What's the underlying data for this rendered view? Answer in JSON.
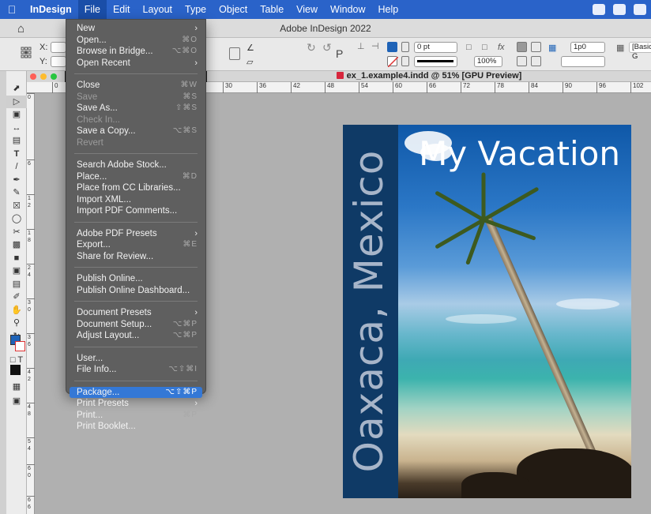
{
  "menubar": {
    "app_name": "InDesign",
    "items": [
      "File",
      "Edit",
      "Layout",
      "Type",
      "Object",
      "Table",
      "View",
      "Window",
      "Help"
    ],
    "active": "File"
  },
  "window": {
    "title": "Adobe InDesign 2022"
  },
  "control_panel": {
    "x_label": "X:",
    "y_label": "Y:",
    "stroke_weight": "0 pt",
    "scale": "100%",
    "gutter": "1p0",
    "style": "[Basic G"
  },
  "doc_tab": {
    "title": "ex_1.example4.indd @ 51% [GPU Preview]"
  },
  "ruler": {
    "h_ticks": [
      "0",
      "30",
      "36",
      "42",
      "48",
      "54",
      "60",
      "66",
      "72",
      "78",
      "84",
      "90",
      "96",
      "102"
    ],
    "v_ticks": [
      "0",
      "6",
      "1\n2",
      "1\n8",
      "2\n4",
      "3\n0",
      "3\n6",
      "4\n2",
      "4\n8",
      "5\n4",
      "6\n0",
      "6\n6"
    ]
  },
  "document": {
    "title": "My Vacation",
    "vertical_text": "Oaxaca, Mexico"
  },
  "file_menu": {
    "groups": [
      [
        {
          "label": "New",
          "shortcut": "",
          "submenu": true,
          "disabled": false
        },
        {
          "label": "Open...",
          "shortcut": "⌘O",
          "submenu": false,
          "disabled": false
        },
        {
          "label": "Browse in Bridge...",
          "shortcut": "⌥⌘O",
          "submenu": false,
          "disabled": false
        },
        {
          "label": "Open Recent",
          "shortcut": "",
          "submenu": true,
          "disabled": false
        }
      ],
      [
        {
          "label": "Close",
          "shortcut": "⌘W",
          "submenu": false,
          "disabled": false
        },
        {
          "label": "Save",
          "shortcut": "⌘S",
          "submenu": false,
          "disabled": true
        },
        {
          "label": "Save As...",
          "shortcut": "⇧⌘S",
          "submenu": false,
          "disabled": false
        },
        {
          "label": "Check In...",
          "shortcut": "",
          "submenu": false,
          "disabled": true
        },
        {
          "label": "Save a Copy...",
          "shortcut": "⌥⌘S",
          "submenu": false,
          "disabled": false
        },
        {
          "label": "Revert",
          "shortcut": "",
          "submenu": false,
          "disabled": true
        }
      ],
      [
        {
          "label": "Search Adobe Stock...",
          "shortcut": "",
          "submenu": false,
          "disabled": false
        },
        {
          "label": "Place...",
          "shortcut": "⌘D",
          "submenu": false,
          "disabled": false
        },
        {
          "label": "Place from CC Libraries...",
          "shortcut": "",
          "submenu": false,
          "disabled": false
        },
        {
          "label": "Import XML...",
          "shortcut": "",
          "submenu": false,
          "disabled": false
        },
        {
          "label": "Import PDF Comments...",
          "shortcut": "",
          "submenu": false,
          "disabled": false
        }
      ],
      [
        {
          "label": "Adobe PDF Presets",
          "shortcut": "",
          "submenu": true,
          "disabled": false
        },
        {
          "label": "Export...",
          "shortcut": "⌘E",
          "submenu": false,
          "disabled": false
        },
        {
          "label": "Share for Review...",
          "shortcut": "",
          "submenu": false,
          "disabled": false
        }
      ],
      [
        {
          "label": "Publish Online...",
          "shortcut": "",
          "submenu": false,
          "disabled": false
        },
        {
          "label": "Publish Online Dashboard...",
          "shortcut": "",
          "submenu": false,
          "disabled": false
        }
      ],
      [
        {
          "label": "Document Presets",
          "shortcut": "",
          "submenu": true,
          "disabled": false
        },
        {
          "label": "Document Setup...",
          "shortcut": "⌥⌘P",
          "submenu": false,
          "disabled": false
        },
        {
          "label": "Adjust Layout...",
          "shortcut": "⌥⌘P",
          "submenu": false,
          "disabled": false
        }
      ],
      [
        {
          "label": "User...",
          "shortcut": "",
          "submenu": false,
          "disabled": false
        },
        {
          "label": "File Info...",
          "shortcut": "⌥⇧⌘I",
          "submenu": false,
          "disabled": false
        }
      ],
      [
        {
          "label": "Package...",
          "shortcut": "⌥⇧⌘P",
          "submenu": false,
          "disabled": false,
          "highlighted": true
        },
        {
          "label": "Print Presets",
          "shortcut": "",
          "submenu": true,
          "disabled": false
        },
        {
          "label": "Print...",
          "shortcut": "⌘P",
          "submenu": false,
          "disabled": false
        },
        {
          "label": "Print Booklet...",
          "shortcut": "",
          "submenu": false,
          "disabled": false
        }
      ]
    ]
  },
  "colors": {
    "menubar": "#2a63c9",
    "menu_bg": "#5f5f5f",
    "menu_highlight": "#3478d6",
    "page_strip": "#0f3a66"
  }
}
